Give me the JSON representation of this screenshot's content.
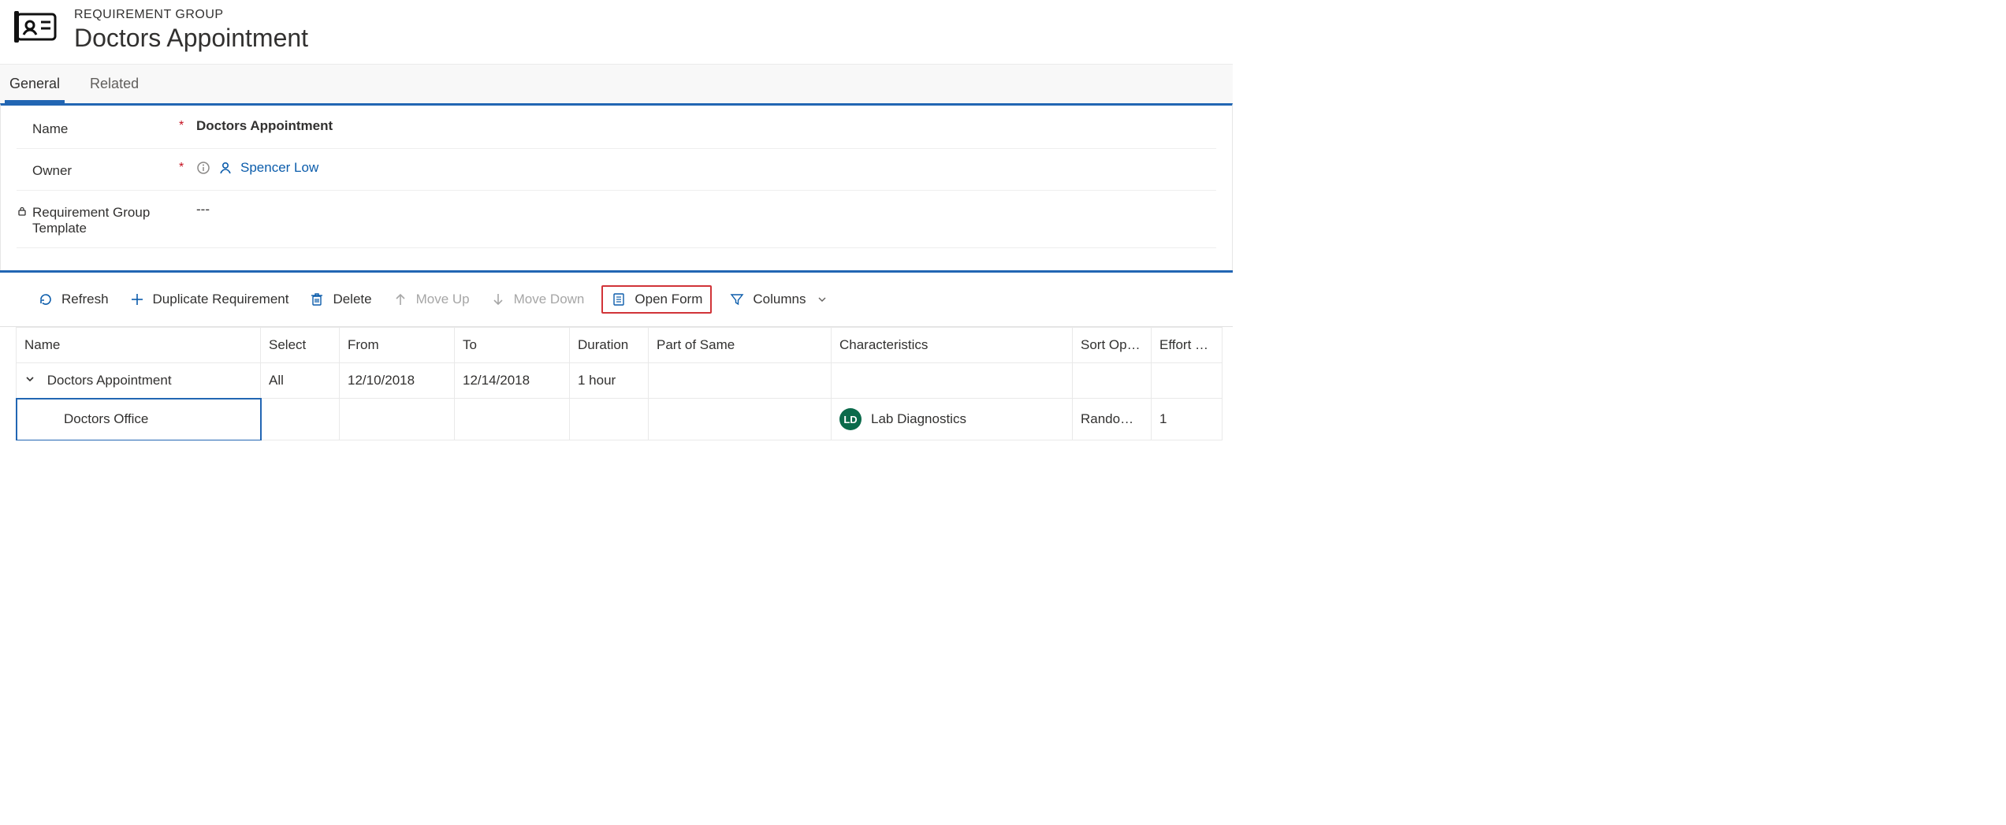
{
  "header": {
    "eyebrow": "REQUIREMENT GROUP",
    "title": "Doctors Appointment"
  },
  "tabs": [
    {
      "label": "General",
      "active": true
    },
    {
      "label": "Related",
      "active": false
    }
  ],
  "form": {
    "name_label": "Name",
    "name_value": "Doctors Appointment",
    "owner_label": "Owner",
    "owner_value": "Spencer Low",
    "template_label": "Requirement Group Template",
    "template_value": "---"
  },
  "toolbar": {
    "refresh": "Refresh",
    "duplicate": "Duplicate Requirement",
    "delete": "Delete",
    "move_up": "Move Up",
    "move_down": "Move Down",
    "open_form": "Open Form",
    "columns": "Columns"
  },
  "grid": {
    "columns": {
      "name": "Name",
      "select": "Select",
      "from": "From",
      "to": "To",
      "duration": "Duration",
      "part_of_same": "Part of Same",
      "characteristics": "Characteristics",
      "sort_option": "Sort Option",
      "effort_required": "Effort Require"
    },
    "rows": [
      {
        "name": "Doctors Appointment",
        "select": "All",
        "from": "12/10/2018",
        "to": "12/14/2018",
        "duration": "1 hour",
        "part_of_same": "",
        "characteristics": "",
        "char_initials": "",
        "sort_option": "",
        "effort_required": ""
      },
      {
        "name": "Doctors Office",
        "select": "",
        "from": "",
        "to": "",
        "duration": "",
        "part_of_same": "",
        "characteristics": "Lab Diagnostics",
        "char_initials": "LD",
        "sort_option": "Randomize",
        "effort_required": "1"
      }
    ]
  }
}
